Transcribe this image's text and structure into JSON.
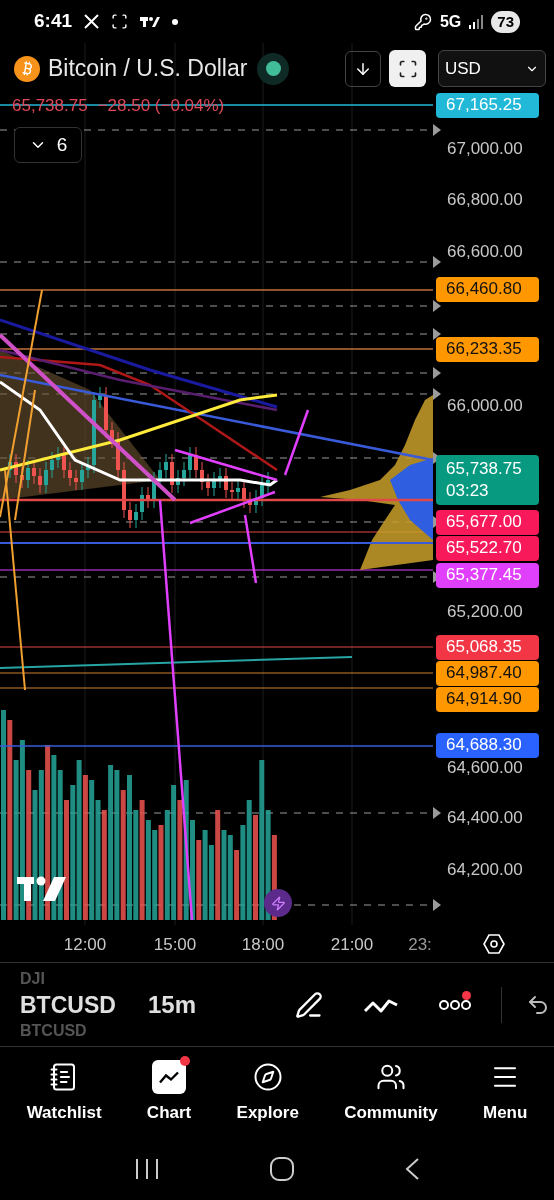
{
  "status_bar": {
    "time": "6:41",
    "network": "5G",
    "battery": "73"
  },
  "header": {
    "title": "Bitcoin / U.S. Dollar",
    "market_open": true,
    "currency": "USD"
  },
  "quote": {
    "price": "65,738.75",
    "change": "−28.50 (−0.04%)"
  },
  "indicators_toggle": {
    "count": "6",
    "expanded": false
  },
  "price_axis": [
    {
      "kind": "tag",
      "label": "67,165.25",
      "color": "#22b8d8"
    },
    {
      "kind": "tick",
      "label": "67,000.00"
    },
    {
      "kind": "tick",
      "label": "66,800.00"
    },
    {
      "kind": "tick",
      "label": "66,600.00"
    },
    {
      "kind": "tag",
      "label": "66,460.80",
      "color": "#ff9800"
    },
    {
      "kind": "tag",
      "label": "66,233.35",
      "color": "#ff9800"
    },
    {
      "kind": "tick",
      "label": "66,000.00"
    },
    {
      "kind": "tag",
      "label": "65,738.75",
      "sub": "03:23",
      "color": "#089981"
    },
    {
      "kind": "tag",
      "label": "65,677.00",
      "color": "#f7195a"
    },
    {
      "kind": "tag",
      "label": "65,522.70",
      "color": "#f7195a"
    },
    {
      "kind": "tag",
      "label": "65,377.45",
      "color": "#e040fb"
    },
    {
      "kind": "tick",
      "label": "65,200.00"
    },
    {
      "kind": "tag",
      "label": "65,068.35",
      "color": "#f23645"
    },
    {
      "kind": "tag",
      "label": "64,987.40",
      "color": "#ff9800"
    },
    {
      "kind": "tag",
      "label": "64,914.90",
      "color": "#ff9800"
    },
    {
      "kind": "tag",
      "label": "64,688.30",
      "color": "#2962ff"
    },
    {
      "kind": "tick",
      "label": "64,600.00"
    },
    {
      "kind": "tick",
      "label": "64,400.00"
    },
    {
      "kind": "tick",
      "label": "64,200.00"
    }
  ],
  "time_axis": [
    "12:00",
    "15:00",
    "18:00",
    "21:00",
    "23:"
  ],
  "symbol_picker": {
    "items": [
      {
        "label": "DJI",
        "selected": false
      },
      {
        "label": "BTCUSD",
        "selected": true
      },
      {
        "label": "BTCUSD",
        "selected": false
      }
    ],
    "interval": "15m"
  },
  "toolbar": {
    "more_notification": true
  },
  "nav": [
    {
      "label": "Watchlist",
      "selected": false,
      "notification": false
    },
    {
      "label": "Chart",
      "selected": true,
      "notification": true
    },
    {
      "label": "Explore",
      "selected": false,
      "notification": false
    },
    {
      "label": "Community",
      "selected": false,
      "notification": false
    },
    {
      "label": "Menu",
      "selected": false,
      "notification": false
    }
  ]
}
